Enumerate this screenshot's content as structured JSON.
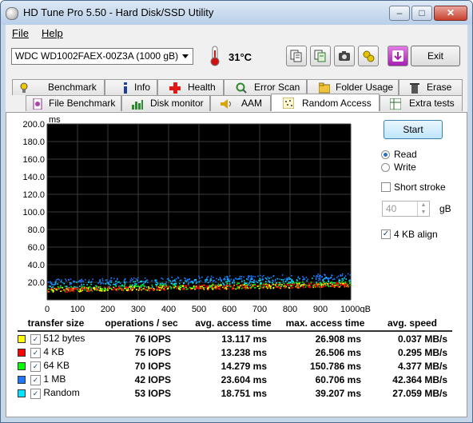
{
  "window": {
    "title": "HD Tune Pro 5.50 - Hard Disk/SSD Utility",
    "minimize": "–",
    "maximize": "□",
    "close": "✕"
  },
  "menu": [
    {
      "label": "File"
    },
    {
      "label": "Help"
    }
  ],
  "toolbar": {
    "drive": "WDC WD1002FAEX-00Z3A (1000 gB)",
    "temperature": "31°C",
    "buttons": [
      {
        "icon": "copy-text-icon"
      },
      {
        "icon": "copy-info-icon"
      },
      {
        "icon": "camera-icon"
      },
      {
        "icon": "options-icon"
      },
      {
        "icon": "download-icon"
      }
    ],
    "exit": "Exit"
  },
  "tabs_row1": [
    {
      "label": "Benchmark",
      "icon": "benchmark-icon"
    },
    {
      "label": "Info",
      "icon": "info-icon"
    },
    {
      "label": "Health",
      "icon": "health-icon"
    },
    {
      "label": "Error Scan",
      "icon": "error-scan-icon"
    },
    {
      "label": "Folder Usage",
      "icon": "folder-icon"
    },
    {
      "label": "Erase",
      "icon": "erase-icon"
    }
  ],
  "tabs_row2": [
    {
      "label": "File Benchmark",
      "icon": "file-benchmark-icon"
    },
    {
      "label": "Disk monitor",
      "icon": "disk-monitor-icon"
    },
    {
      "label": "AAM",
      "icon": "speaker-icon"
    },
    {
      "label": "Random Access",
      "icon": "random-access-icon",
      "active": true
    },
    {
      "label": "Extra tests",
      "icon": "extra-tests-icon"
    }
  ],
  "controls": {
    "start": "Start",
    "read": "Read",
    "write": "Write",
    "mode": "read",
    "short_stroke": "Short stroke",
    "short_stroke_checked": false,
    "stroke_value": "40",
    "stroke_unit": "gB",
    "align": "4 KB align",
    "align_checked": true
  },
  "chart_data": {
    "type": "scatter",
    "ylabel": "ms",
    "yticks": [
      "200.0",
      "180.0",
      "160.0",
      "140.0",
      "120.0",
      "100.0",
      "80.0",
      "60.0",
      "40.0",
      "20.0"
    ],
    "xticks": [
      "0",
      "100",
      "200",
      "300",
      "400",
      "500",
      "600",
      "700",
      "800",
      "900",
      "1000gB"
    ],
    "xlim": [
      0,
      1000
    ],
    "ylim": [
      0,
      200
    ],
    "grid": true,
    "series": [
      {
        "name": "512 bytes",
        "color": "#ffff00",
        "base_ms": 11,
        "slope_ms_per_gb": 0.006,
        "spread_ms": 5
      },
      {
        "name": "4 KB",
        "color": "#ff0000",
        "base_ms": 11,
        "slope_ms_per_gb": 0.006,
        "spread_ms": 5
      },
      {
        "name": "64 KB",
        "color": "#00ff00",
        "base_ms": 12,
        "slope_ms_per_gb": 0.006,
        "spread_ms": 6
      },
      {
        "name": "1 MB",
        "color": "#1e78ff",
        "base_ms": 20,
        "slope_ms_per_gb": 0.006,
        "spread_ms": 7
      },
      {
        "name": "Random",
        "color": "#00e6ff",
        "base_ms": 16,
        "slope_ms_per_gb": 0.006,
        "spread_ms": 8
      }
    ]
  },
  "results": {
    "headers": [
      "transfer size",
      "operations / sec",
      "avg. access time",
      "max. access time",
      "avg. speed"
    ],
    "rows": [
      {
        "size": "512 bytes",
        "color": "#ffff00",
        "ops": "76 IOPS",
        "avg": "13.117 ms",
        "max": "26.908 ms",
        "speed": "0.037 MB/s"
      },
      {
        "size": "4 KB",
        "color": "#ff0000",
        "ops": "75 IOPS",
        "avg": "13.238 ms",
        "max": "26.506 ms",
        "speed": "0.295 MB/s"
      },
      {
        "size": "64 KB",
        "color": "#00ff00",
        "ops": "70 IOPS",
        "avg": "14.279 ms",
        "max": "150.786 ms",
        "speed": "4.377 MB/s"
      },
      {
        "size": "1 MB",
        "color": "#1e78ff",
        "ops": "42 IOPS",
        "avg": "23.604 ms",
        "max": "60.706 ms",
        "speed": "42.364 MB/s"
      },
      {
        "size": "Random",
        "color": "#00e6ff",
        "ops": "53 IOPS",
        "avg": "18.751 ms",
        "max": "39.207 ms",
        "speed": "27.059 MB/s"
      }
    ]
  }
}
